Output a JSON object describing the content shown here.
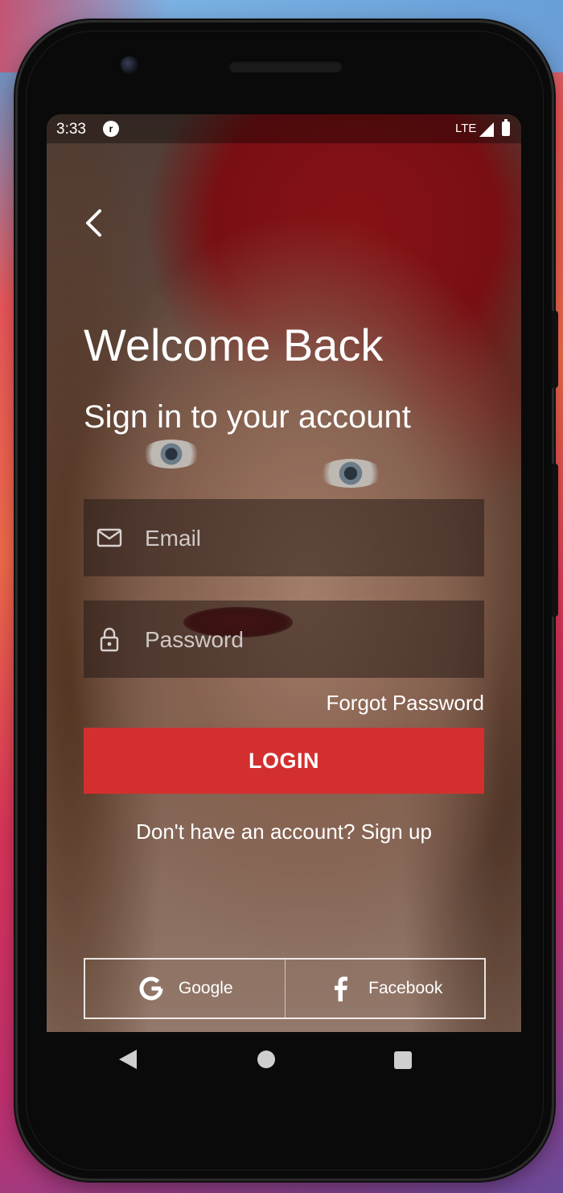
{
  "status_bar": {
    "time": "3:33",
    "notification_icon": "app-notification-icon",
    "network": "LTE",
    "signal_icon": "signal-icon",
    "battery_icon": "battery-icon"
  },
  "login": {
    "back_icon": "chevron-left-icon",
    "title": "Welcome Back",
    "subtitle": "Sign in to your account",
    "email": {
      "placeholder": "Email",
      "value": "",
      "icon": "mail-icon"
    },
    "password": {
      "placeholder": "Password",
      "value": "",
      "icon": "lock-icon"
    },
    "forgot_password": "Forgot Password",
    "login_button": "LOGIN",
    "signup_prompt": "Don't have an account?",
    "signup_link": "Sign up"
  },
  "social": {
    "google_label": "Google",
    "facebook_label": "Facebook"
  },
  "colors": {
    "accent": "#d42f2f",
    "text": "#ffffff"
  }
}
